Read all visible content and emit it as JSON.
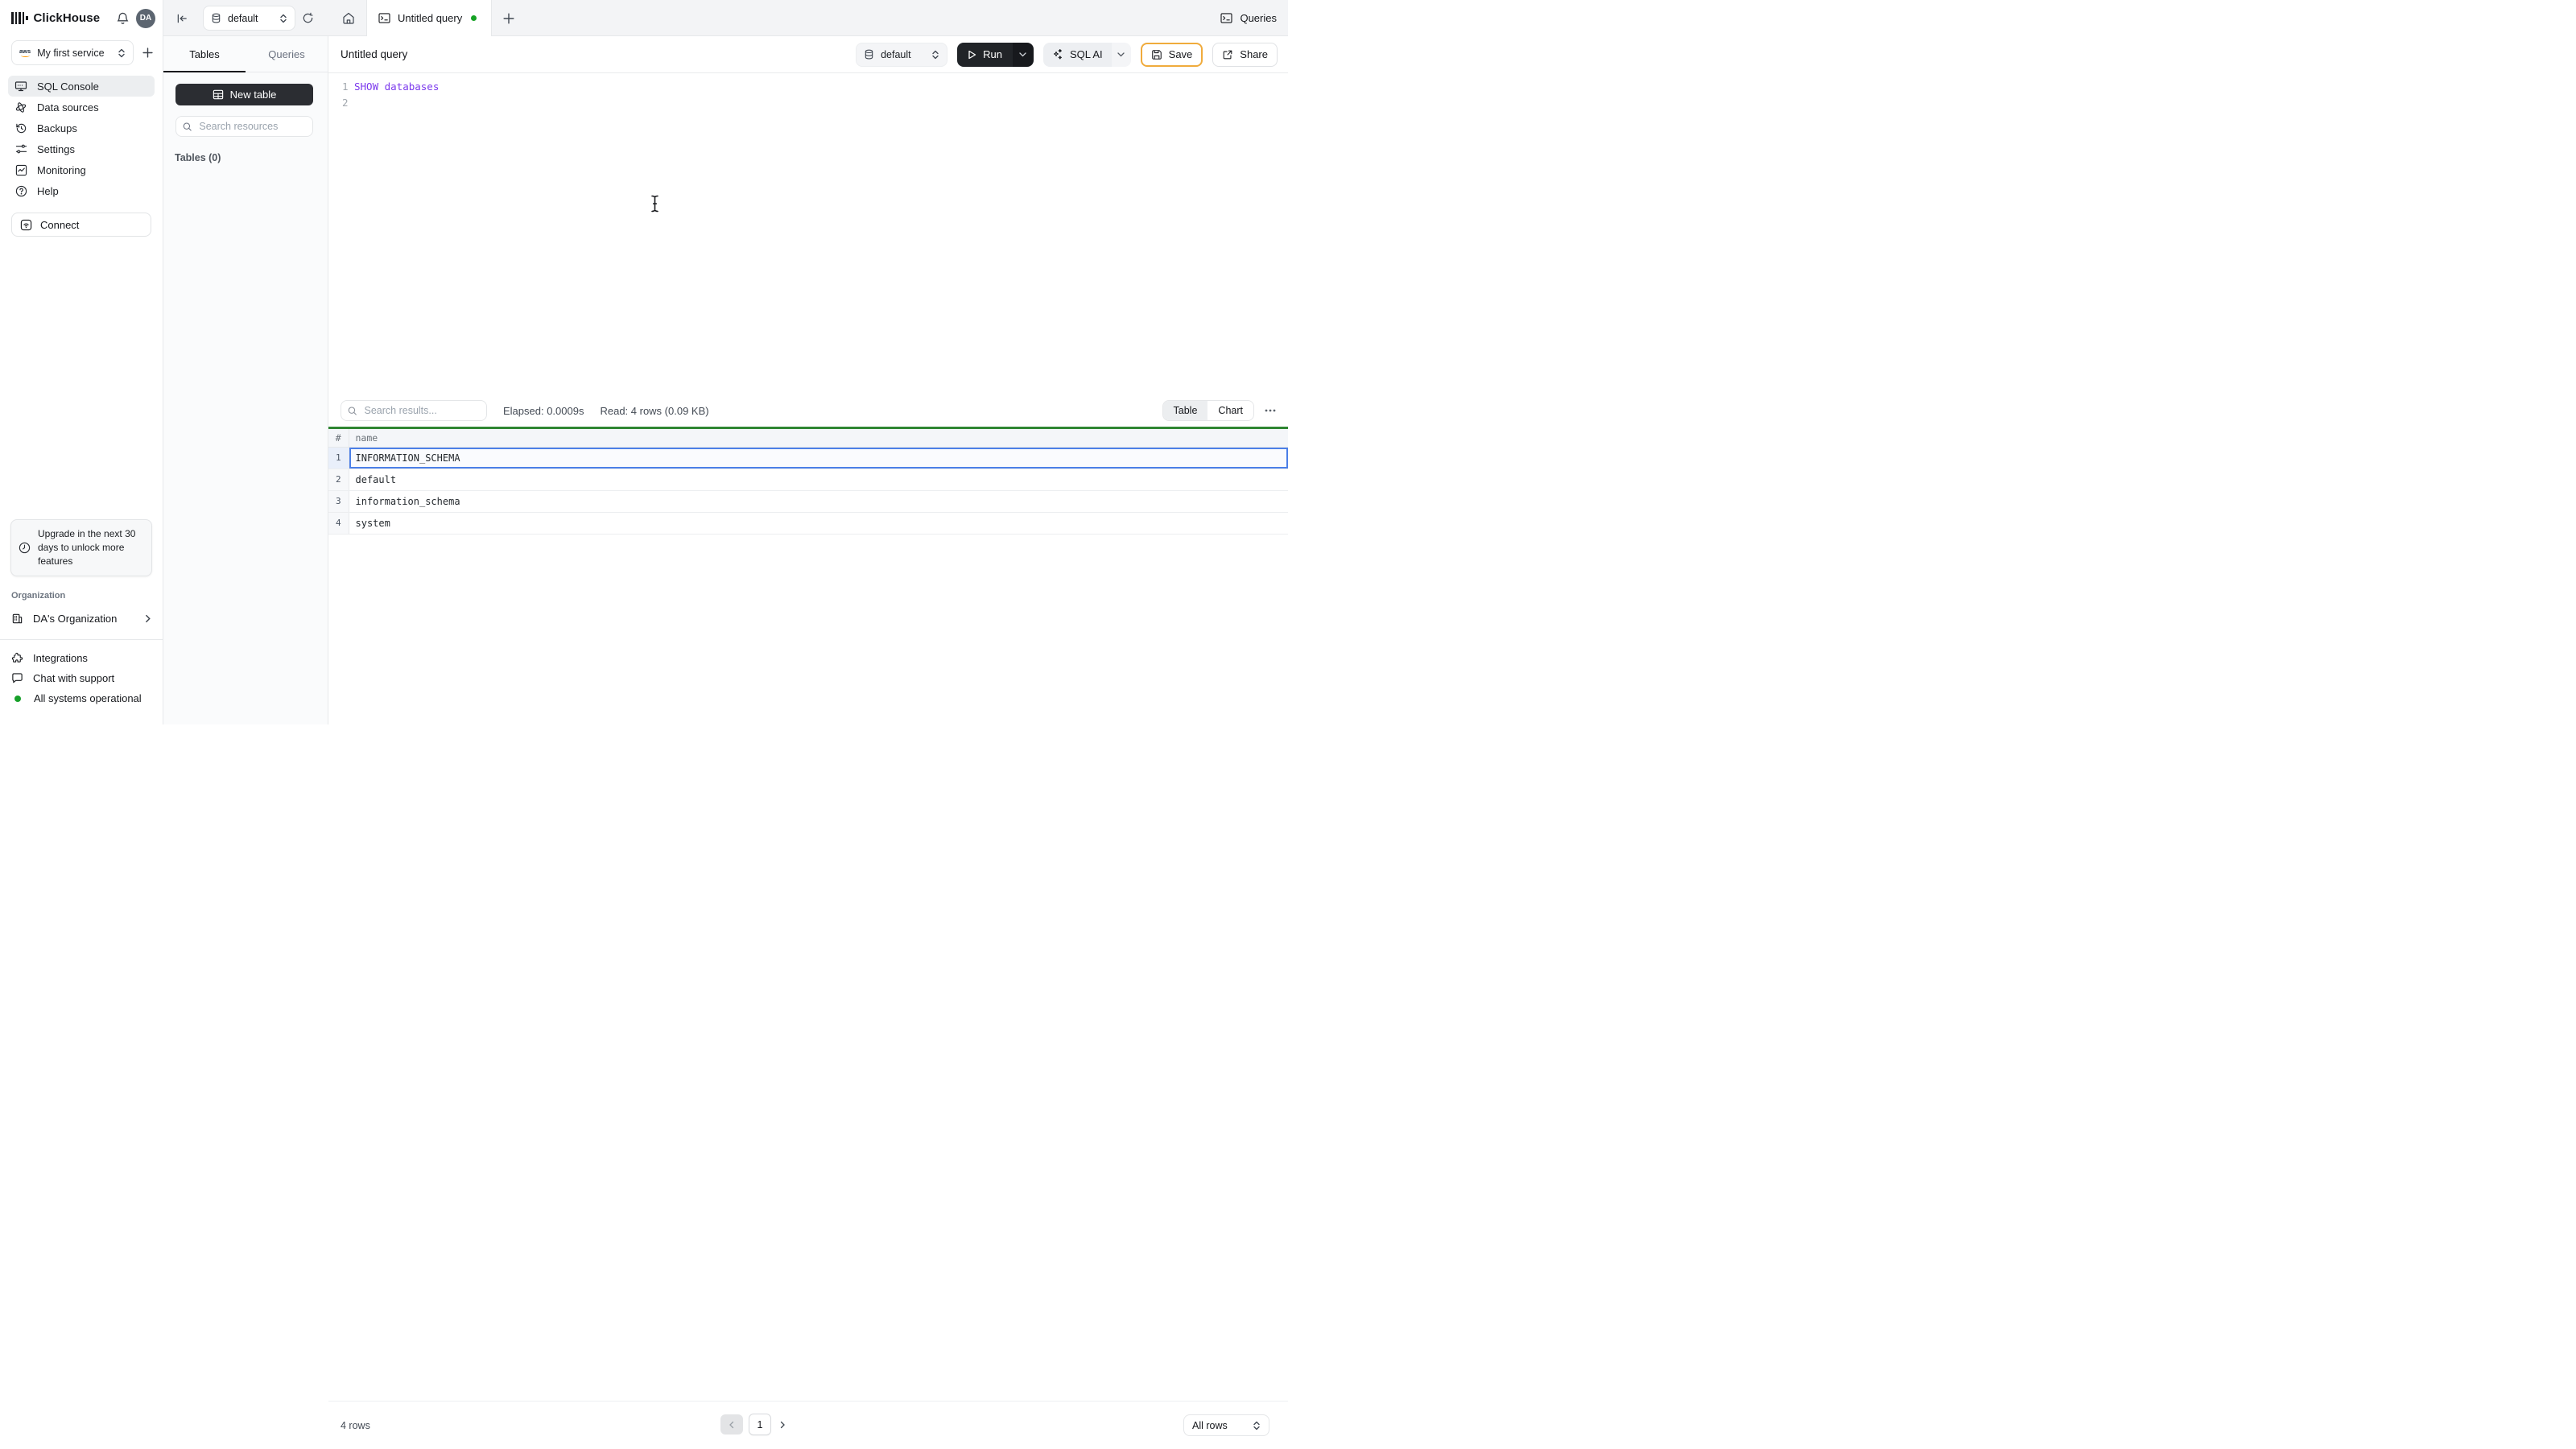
{
  "header": {
    "brand": "ClickHouse",
    "avatar_initials": "DA"
  },
  "sidebar": {
    "service": {
      "label": "My first service",
      "provider": "aws"
    },
    "items": [
      {
        "label": "SQL Console",
        "icon": "console-icon",
        "active": true
      },
      {
        "label": "Data sources",
        "icon": "data-sources-icon",
        "active": false
      },
      {
        "label": "Backups",
        "icon": "backups-icon",
        "active": false
      },
      {
        "label": "Settings",
        "icon": "settings-icon",
        "active": false
      },
      {
        "label": "Monitoring",
        "icon": "monitoring-icon",
        "active": false
      },
      {
        "label": "Help",
        "icon": "help-icon",
        "active": false
      }
    ],
    "connect_label": "Connect",
    "upgrade_notice": "Upgrade in the next 30 days to unlock more features",
    "org_section_label": "Organization",
    "org_name": "DA's Organization",
    "footer_items": [
      {
        "label": "Integrations",
        "icon": "puzzle-icon"
      },
      {
        "label": "Chat with support",
        "icon": "chat-icon"
      }
    ],
    "status_label": "All systems operational",
    "status_color": "#17a02a"
  },
  "explorer": {
    "tabs": [
      {
        "label": "Tables",
        "active": true
      },
      {
        "label": "Queries",
        "active": false
      }
    ],
    "new_table_label": "New table",
    "search_placeholder": "Search resources",
    "section_label": "Tables (0)"
  },
  "strip": {
    "database": "default",
    "tab_title": "Untitled query",
    "tab_dirty": true,
    "queries_label": "Queries"
  },
  "query": {
    "title": "Untitled query",
    "database": "default",
    "run_label": "Run",
    "sql_ai_label": "SQL AI",
    "save_label": "Save",
    "share_label": "Share"
  },
  "editor": {
    "lines": [
      {
        "number": "1",
        "code": "SHOW databases"
      },
      {
        "number": "2",
        "code": ""
      }
    ],
    "code_color": "#7c3aed"
  },
  "results": {
    "search_placeholder": "Search results...",
    "elapsed": "Elapsed: 0.0009s",
    "read": "Read: 4 rows (0.09 KB)",
    "views": [
      "Table",
      "Chart"
    ],
    "active_view": "Table",
    "columns": [
      "#",
      "name"
    ],
    "rows": [
      {
        "n": "1",
        "name": "INFORMATION_SCHEMA",
        "selected": true
      },
      {
        "n": "2",
        "name": "default",
        "selected": false
      },
      {
        "n": "3",
        "name": "information_schema",
        "selected": false
      },
      {
        "n": "4",
        "name": "system",
        "selected": false
      }
    ],
    "footer": {
      "row_count": "4 rows",
      "page": "1",
      "page_size": "All rows"
    },
    "accent_green": "#2f8632",
    "selection_blue": "#4b7fe8"
  }
}
